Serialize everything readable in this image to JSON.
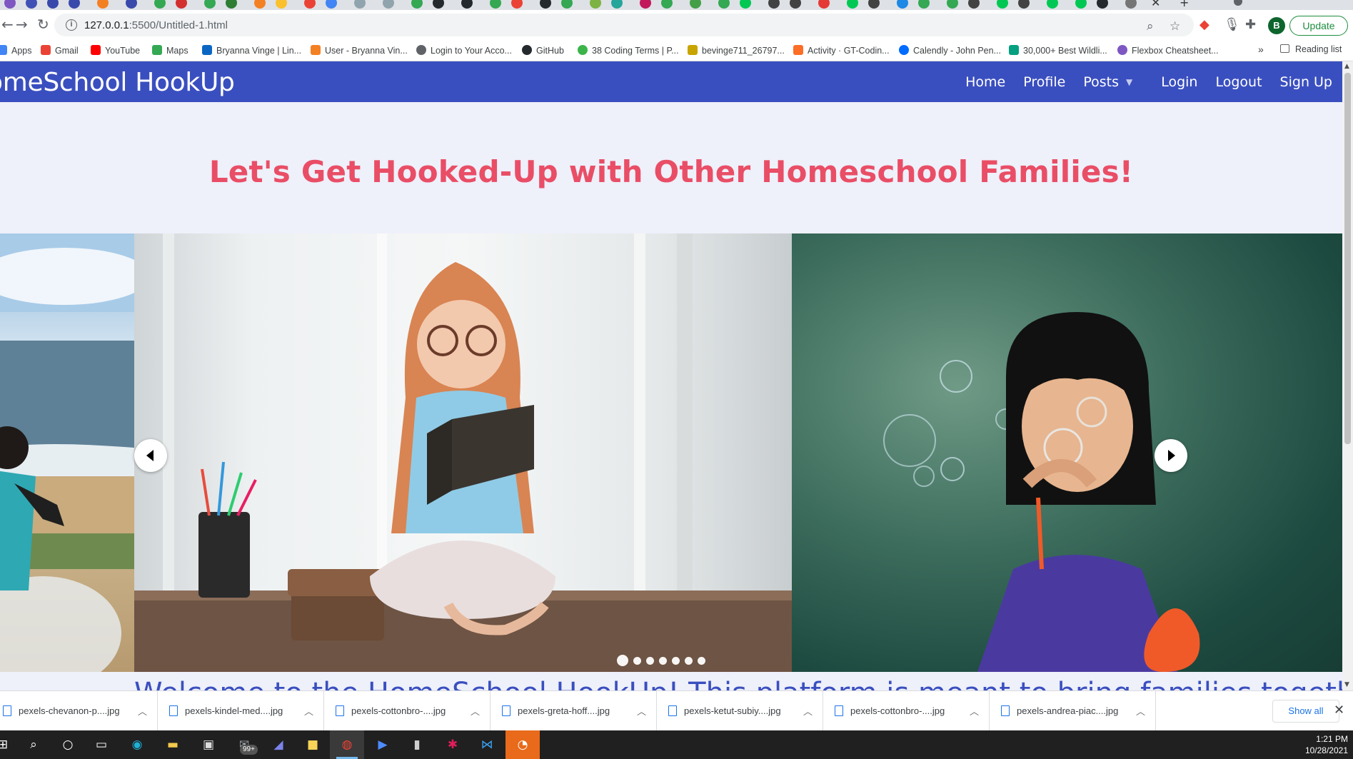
{
  "browser": {
    "url_host": "127.0.0.1",
    "url_path": ":5500/Untitled-1.html",
    "profile_initial": "B",
    "update_label": "Update",
    "bookmarks": [
      {
        "label": "Apps",
        "color": "#4285f4"
      },
      {
        "label": "Gmail",
        "color": "#ea4335"
      },
      {
        "label": "YouTube",
        "color": "#ff0000"
      },
      {
        "label": "Maps",
        "color": "#34a853"
      },
      {
        "label": "Bryanna Vinge | Lin...",
        "color": "#0a66c2"
      },
      {
        "label": "User - Bryanna Vin...",
        "color": "#f48024"
      },
      {
        "label": "Login to Your Acco...",
        "color": "#5f6368"
      },
      {
        "label": "GitHub",
        "color": "#24292e"
      },
      {
        "label": "38 Coding Terms | P...",
        "color": "#3bb54a"
      },
      {
        "label": "bevinge711_26797...",
        "color": "#c8a400"
      },
      {
        "label": "Activity · GT-Codin...",
        "color": "#fc6d26"
      },
      {
        "label": "Calendly - John Pen...",
        "color": "#006bff"
      },
      {
        "label": "30,000+ Best Wildli...",
        "color": "#05a081"
      },
      {
        "label": "Flexbox Cheatsheet...",
        "color": "#7e57c2"
      }
    ],
    "reading_list": "Reading list"
  },
  "site": {
    "brand": "omeSchool HookUp",
    "nav": {
      "home": "Home",
      "profile": "Profile",
      "posts": "Posts",
      "login": "Login",
      "logout": "Logout",
      "signup": "Sign Up"
    },
    "hero_title": "Let's Get Hooked-Up with Other Homeschool Families!",
    "welcome_text": "Welcome to the HomeSchool HookUp! This platform is meant to bring families together of",
    "carousel": {
      "slides": [
        "beach-kid-splashing",
        "girl-reading-book",
        "girl-blowing-bubbles"
      ],
      "dot_count": 7,
      "active_index": 0
    }
  },
  "downloads": {
    "files": [
      "pexels-chevanon-p....jpg",
      "pexels-kindel-med....jpg",
      "pexels-cottonbro-....jpg",
      "pexels-greta-hoff....jpg",
      "pexels-ketut-subiy....jpg",
      "pexels-cottonbro-....jpg",
      "pexels-andrea-piac....jpg"
    ],
    "show_all": "Show all"
  },
  "taskbar": {
    "time": "1:21 PM",
    "date": "10/28/2021",
    "mail_badge": "99+"
  }
}
